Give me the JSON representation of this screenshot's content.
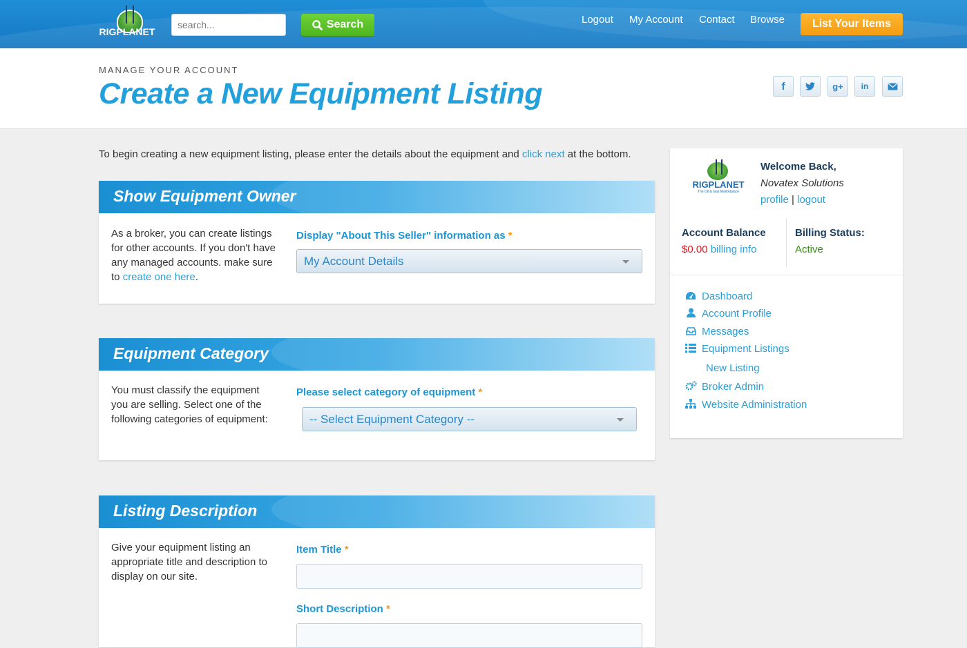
{
  "header": {
    "logo_text": "RIGPLANET",
    "search_placeholder": "search...",
    "search_button": "Search",
    "nav": [
      "Logout",
      "My Account",
      "Contact",
      "Browse"
    ],
    "cta": "List Your Items"
  },
  "title_band": {
    "kicker": "MANAGE YOUR ACCOUNT",
    "title": "Create a New Equipment Listing",
    "social": [
      "facebook",
      "twitter",
      "google-plus",
      "linkedin",
      "email"
    ]
  },
  "intro": {
    "before": "To begin creating a new equipment listing, please enter the details about the equipment and ",
    "link": "click next",
    "after": " at the bottom."
  },
  "panels": {
    "owner": {
      "title": "Show Equipment Owner",
      "desc_text": "As a broker, you can create listings for other accounts. If you don't have any managed accounts. make sure to ",
      "desc_link": "create one here",
      "desc_end": ".",
      "label": "Display \"About This Seller\" information as",
      "required": "*",
      "selected": "My Account Details"
    },
    "category": {
      "title": "Equipment Category",
      "desc_text": "You must classify the equipment you are selling. Select one of the following categories of equipment:",
      "label": "Please select category of equipment",
      "required": "*",
      "selected": "-- Select Equipment Category --"
    },
    "description": {
      "title": "Listing Description",
      "desc_text": "Give your equipment listing an appropriate title and description to display on our site.",
      "item_title_label": "Item Title",
      "short_desc_label": "Short Description",
      "required": "*",
      "item_title_value": "",
      "short_desc_value": ""
    }
  },
  "sidebar": {
    "logo_text": "RIGPLANET",
    "logo_tagline": "The Oil & Gas Marketplace",
    "welcome": "Welcome Back,",
    "company": "Novatex Solutions",
    "profile_link": "profile",
    "separator": "|",
    "logout_link": "logout",
    "balance_label": "Account Balance",
    "balance_value": "$0.00",
    "billing_link": "billing info",
    "billing_status_label": "Billing Status:",
    "billing_status_value": "Active",
    "menu": [
      {
        "label": "Dashboard",
        "icon": "dashboard-icon"
      },
      {
        "label": "Account Profile",
        "icon": "user-icon"
      },
      {
        "label": "Messages",
        "icon": "inbox-icon"
      },
      {
        "label": "Equipment Listings",
        "icon": "list-icon"
      },
      {
        "label": "New Listing",
        "icon": ""
      },
      {
        "label": "Broker Admin",
        "icon": "cogs-icon"
      },
      {
        "label": "Website Administration",
        "icon": "sitemap-icon"
      }
    ]
  },
  "colors": {
    "header_blue": "#1b86cf",
    "accent_blue": "#22a0dc",
    "search_green": "#4fb51f",
    "cta_orange": "#f59d12",
    "required_orange": "#f39a16",
    "balance_red": "#e0131b",
    "status_green": "#3a8a1c"
  }
}
